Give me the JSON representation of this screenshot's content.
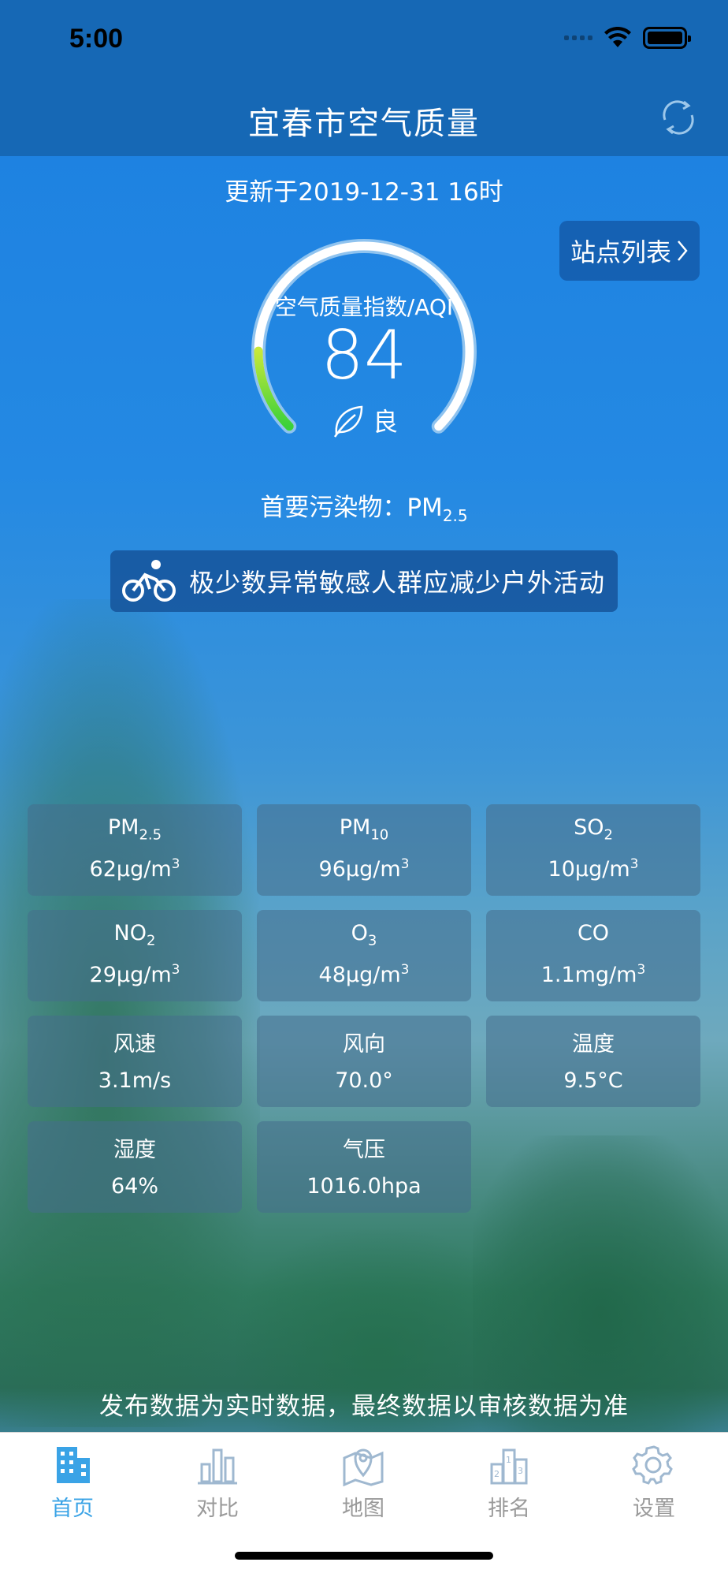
{
  "status_bar": {
    "time": "5:00"
  },
  "header": {
    "title": "宜春市空气质量",
    "refresh_icon": "refresh-icon"
  },
  "update_time": "更新于2019-12-31 16时",
  "station_list_button": {
    "label": "站点列表",
    "icon": "chevron-right-icon"
  },
  "aqi": {
    "label": "空气质量指数/AQI",
    "value": "84",
    "level": "良",
    "level_icon": "leaf-icon",
    "gauge_fraction": 0.168,
    "gauge_color_start": "#3ad13a",
    "gauge_color_end": "#c8e83a",
    "track_color": "#ffffff"
  },
  "primary_pollutant": {
    "prefix": "首要污染物：",
    "name": "PM",
    "sub": "2.5"
  },
  "advice": {
    "icon": "bicycle-icon",
    "text": "极少数异常敏感人群应减少户外活动"
  },
  "metrics": [
    {
      "name": "PM",
      "sub": "2.5",
      "value": "62μg/m",
      "sup": "3"
    },
    {
      "name": "PM",
      "sub": "10",
      "value": "96μg/m",
      "sup": "3"
    },
    {
      "name": "SO",
      "sub": "2",
      "value": "10μg/m",
      "sup": "3"
    },
    {
      "name": "NO",
      "sub": "2",
      "value": "29μg/m",
      "sup": "3"
    },
    {
      "name": "O",
      "sub": "3",
      "value": "48μg/m",
      "sup": "3"
    },
    {
      "name": "CO",
      "sub": "",
      "value": "1.1mg/m",
      "sup": "3"
    },
    {
      "name": "风速",
      "sub": "",
      "value": "3.1m/s",
      "sup": ""
    },
    {
      "name": "风向",
      "sub": "",
      "value": "70.0°",
      "sup": ""
    },
    {
      "name": "温度",
      "sub": "",
      "value": "9.5°C",
      "sup": ""
    },
    {
      "name": "湿度",
      "sub": "",
      "value": "64%",
      "sup": ""
    },
    {
      "name": "气压",
      "sub": "",
      "value": "1016.0hpa",
      "sup": ""
    }
  ],
  "disclaimer": "发布数据为实时数据，最终数据以审核数据为准",
  "tabs": [
    {
      "label": "首页",
      "icon": "building-icon",
      "active": true
    },
    {
      "label": "对比",
      "icon": "bar-chart-icon",
      "active": false
    },
    {
      "label": "地图",
      "icon": "map-pin-icon",
      "active": false
    },
    {
      "label": "排名",
      "icon": "podium-icon",
      "active": false
    },
    {
      "label": "设置",
      "icon": "gear-icon",
      "active": false
    }
  ],
  "colors": {
    "accent": "#3aa3e6",
    "header": "#1668b5",
    "inactive_tab": "#9a9a9a"
  }
}
